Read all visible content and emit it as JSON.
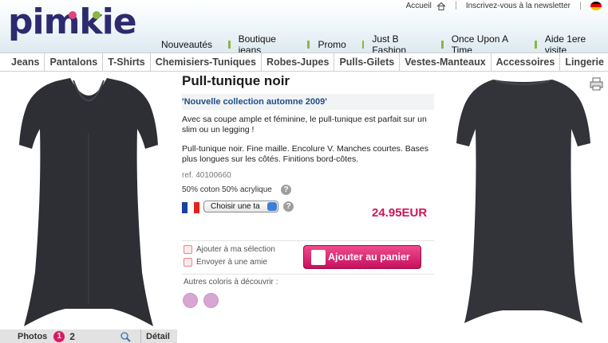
{
  "brand": {
    "logo_text": "pimkie",
    "logo_color": "#2d2b6f"
  },
  "topbar": {
    "home_label": "Accueil",
    "newsletter_label": "Inscrivez-vous à la newsletter"
  },
  "main_nav": [
    {
      "label": "Nouveautés"
    },
    {
      "label": "Boutique jeans"
    },
    {
      "label": "Promo"
    },
    {
      "label": "Just B Fashion"
    },
    {
      "label": "Once Upon A Time"
    },
    {
      "label": "Aide 1ere visite"
    }
  ],
  "categories": [
    {
      "label": "Jeans"
    },
    {
      "label": "Pantalons"
    },
    {
      "label": "T-Shirts"
    },
    {
      "label": "Chemisiers-Tuniques"
    },
    {
      "label": "Robes-Jupes"
    },
    {
      "label": "Pulls-Gilets"
    },
    {
      "label": "Vestes-Manteaux"
    },
    {
      "label": "Accessoires"
    },
    {
      "label": "Lingerie"
    }
  ],
  "product": {
    "title": "Pull-tunique noir",
    "collection": "'Nouvelle collection automne 2009'",
    "description_1": "Avec sa coupe ample et féminine, le pull-tunique est parfait sur un slim ou un legging !",
    "description_2": "Pull-tunique noir. Fine maille. Encolure V. Manches courtes. Bases plus longues sur les côtés. Finitions bord-côtes.",
    "reference": "ref. 40100660",
    "composition": "50% coton 50% acrylique",
    "size_select_value": "Choisir une ta",
    "price": "24.95EUR",
    "price_color": "#d0145a",
    "add_selection_label": "Ajouter à ma sélection",
    "send_friend_label": "Envoyer à une amie",
    "add_to_cart_label": "Ajouter au panier",
    "other_colors_label": "Autres coloris à découvrir :",
    "swatch_color": "#d7a6d3"
  },
  "photo_bar": {
    "photos_label": "Photos",
    "pages": [
      "1",
      "2"
    ],
    "active_page": "1",
    "detail_label": "Détail"
  },
  "help_symbol": "?"
}
